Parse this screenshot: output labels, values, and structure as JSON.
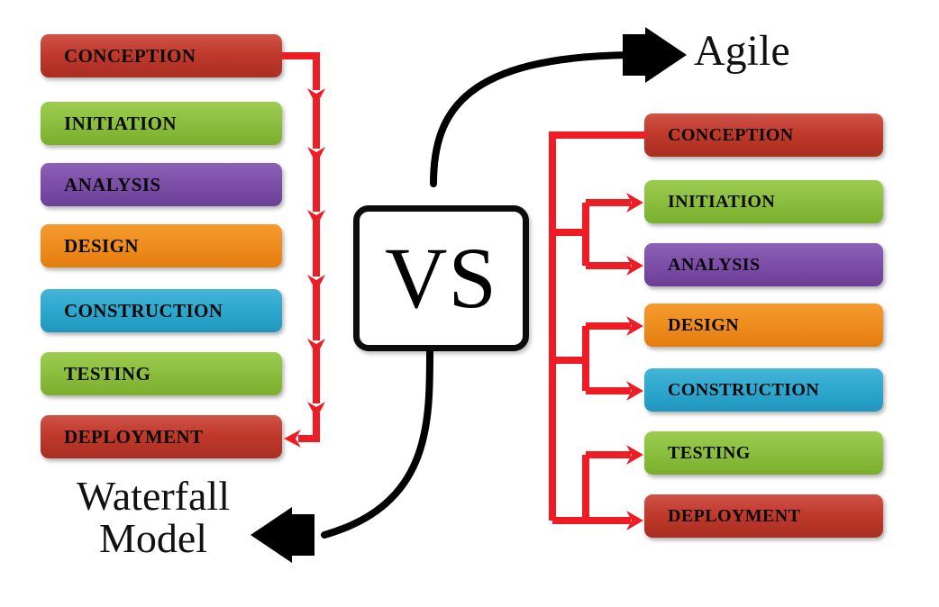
{
  "diagram": {
    "title_left": "Waterfall\nModel",
    "title_right": "Agile",
    "center_label": "VS",
    "colors": {
      "red": "#c0392b",
      "green": "#8cbf3f",
      "purple": "#7d4fa8",
      "orange": "#ef8d1f",
      "blue": "#2ea8cf",
      "arrow_red": "#ee1c25",
      "arrow_black": "#000000",
      "background": "#ffffff"
    },
    "left_column": {
      "name": "waterfall-model",
      "stages": [
        {
          "label": "CONCEPTION",
          "color": "#c0392b",
          "color_top": "#cf5348",
          "color_bottom": "#a92e22"
        },
        {
          "label": "INITIATION",
          "color": "#8cbf3f",
          "color_top": "#9ccb50",
          "color_bottom": "#7aae2c"
        },
        {
          "label": "ANALYSIS",
          "color": "#7d4fa8",
          "color_top": "#8d61b6",
          "color_bottom": "#6c3f97"
        },
        {
          "label": "DESIGN",
          "color": "#ef8d1f",
          "color_top": "#f59a2e",
          "color_bottom": "#e47d0c"
        },
        {
          "label": "CONSTRUCTION",
          "color": "#2ea8cf",
          "color_top": "#44b5d8",
          "color_bottom": "#2096bd"
        },
        {
          "label": "TESTING",
          "color": "#8cbf3f",
          "color_top": "#9ccb50",
          "color_bottom": "#7aae2c"
        },
        {
          "label": "DEPLOYMENT",
          "color": "#c0392b",
          "color_top": "#cf5348",
          "color_bottom": "#a92e22"
        }
      ]
    },
    "right_column": {
      "name": "agile-model",
      "stages": [
        {
          "label": "CONCEPTION",
          "color": "#c0392b",
          "color_top": "#cf5348",
          "color_bottom": "#a92e22"
        },
        {
          "label": "INITIATION",
          "color": "#8cbf3f",
          "color_top": "#9ccb50",
          "color_bottom": "#7aae2c"
        },
        {
          "label": "ANALYSIS",
          "color": "#7d4fa8",
          "color_top": "#8d61b6",
          "color_bottom": "#6c3f97"
        },
        {
          "label": "DESIGN",
          "color": "#ef8d1f",
          "color_top": "#f59a2e",
          "color_bottom": "#e47d0c"
        },
        {
          "label": "CONSTRUCTION",
          "color": "#2ea8cf",
          "color_top": "#44b5d8",
          "color_bottom": "#2096bd"
        },
        {
          "label": "TESTING",
          "color": "#8cbf3f",
          "color_top": "#9ccb50",
          "color_bottom": "#7aae2c"
        },
        {
          "label": "DEPLOYMENT",
          "color": "#c0392b",
          "color_top": "#cf5348",
          "color_bottom": "#a92e22"
        }
      ]
    }
  }
}
